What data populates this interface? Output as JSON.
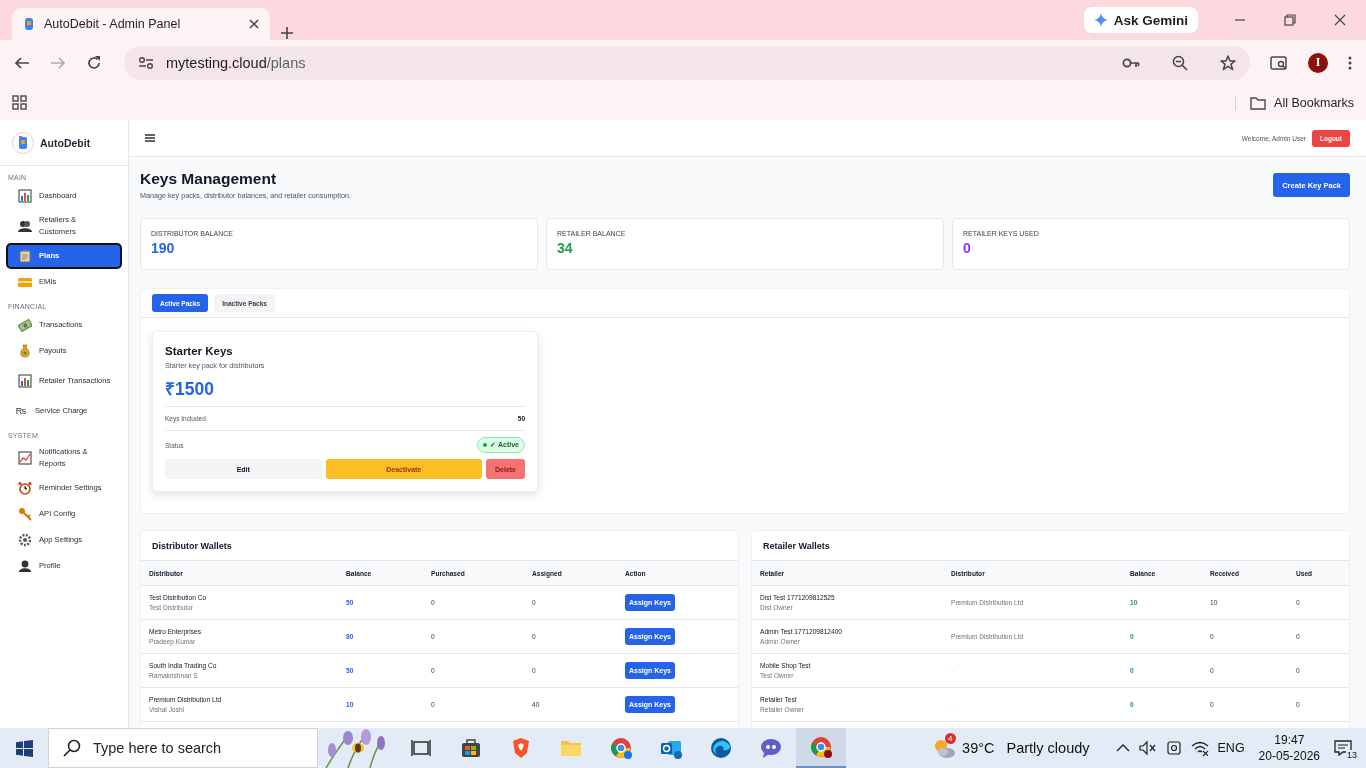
{
  "browser": {
    "tab_title": "AutoDebit - Admin Panel",
    "ask_gemini": "Ask Gemini",
    "url_host": "mytesting.cloud",
    "url_path": "/plans",
    "bookmarks_label": "All Bookmarks",
    "profile_initial": "I"
  },
  "sidebar": {
    "brand": "AutoDebit",
    "sections": [
      {
        "label": "MAIN",
        "items": [
          {
            "label": "Dashboard",
            "selected": false
          },
          {
            "label": "Retailers & Customers",
            "selected": false
          },
          {
            "label": "Plans",
            "selected": true
          },
          {
            "label": "EMIs",
            "selected": false
          }
        ]
      },
      {
        "label": "FINANCIAL",
        "items": [
          {
            "label": "Transactions",
            "selected": false
          },
          {
            "label": "Payouts",
            "selected": false
          },
          {
            "label": "Retailer Transactions",
            "selected": false
          },
          {
            "label": "Service Charge",
            "selected": false,
            "glyph": "₨"
          }
        ]
      },
      {
        "label": "SYSTEM",
        "items": [
          {
            "label": "Notifications & Reports",
            "selected": false
          },
          {
            "label": "Reminder Settings",
            "selected": false
          },
          {
            "label": "API Config",
            "selected": false
          },
          {
            "label": "App Settings",
            "selected": false
          },
          {
            "label": "Profile",
            "selected": false
          }
        ]
      }
    ]
  },
  "header": {
    "welcome": "Welcome, Admin User",
    "logout": "Logout"
  },
  "page": {
    "title": "Keys Management",
    "subtitle": "Manage key packs, distributor balances, and retailer consumption.",
    "create_button": "Create Key Pack"
  },
  "stats": [
    {
      "label": "DISTRIBUTOR BALANCE",
      "value": "190",
      "color": "#2563eb"
    },
    {
      "label": "RETAILER BALANCE",
      "value": "34",
      "color": "#16a34a"
    },
    {
      "label": "RETAILER KEYS USED",
      "value": "0",
      "color": "#9333ea"
    }
  ],
  "pack_tabs": [
    {
      "label": "Active Packs",
      "selected": true
    },
    {
      "label": "Inactive Packs",
      "selected": false
    }
  ],
  "pack_card": {
    "name": "Starter Keys",
    "description": "Starter key pack for distributors",
    "price": "₹1500",
    "keys_label": "Keys Included",
    "keys_value": "50",
    "status_label": "Status",
    "status_badge": "✓ Active",
    "active": true,
    "buttons": [
      {
        "label": "Edit",
        "kind": "edit"
      },
      {
        "label": "Deactivate",
        "kind": "deactivate"
      },
      {
        "label": "Delete",
        "kind": "delete"
      }
    ]
  },
  "distributor_wallets": {
    "title": "Distributor Wallets",
    "columns": [
      "Distributor",
      "Balance",
      "Purchased",
      "Assigned",
      "Action"
    ],
    "rows": [
      {
        "name": "Test Distribution Co",
        "owner": "Test Distributor",
        "balance": "50",
        "purchased": "0",
        "assigned": "0",
        "action": "Assign Keys"
      },
      {
        "name": "Metro Enterprises",
        "owner": "Pradeep Kumar",
        "balance": "80",
        "purchased": "0",
        "assigned": "0",
        "action": "Assign Keys"
      },
      {
        "name": "South India Trading Co",
        "owner": "Ramakrishnan S",
        "balance": "50",
        "purchased": "0",
        "assigned": "0",
        "action": "Assign Keys"
      },
      {
        "name": "Premium Distribution Ltd",
        "owner": "Vishal Joshi",
        "balance": "10",
        "purchased": "0",
        "assigned": "40",
        "action": "Assign Keys"
      }
    ]
  },
  "retailer_wallets": {
    "title": "Retailer Wallets",
    "columns": [
      "Retailer",
      "Distributor",
      "Balance",
      "Received",
      "Used"
    ],
    "rows": [
      {
        "name": "Dist Test 1771209812525",
        "owner": "Dist Owner",
        "distributor": "Premium Distribution Ltd",
        "balance": "10",
        "received": "10",
        "used": "0"
      },
      {
        "name": "Admin Test 1771209812400",
        "owner": "Admin Owner",
        "distributor": "Premium Distribution Ltd",
        "balance": "0",
        "received": "0",
        "used": "0"
      },
      {
        "name": "Mobile Shop Test",
        "owner": "Test Owner",
        "distributor": "-",
        "balance": "0",
        "received": "0",
        "used": "0"
      },
      {
        "name": "Retailer Test",
        "owner": "Retailer Owner",
        "distributor": "-",
        "balance": "0",
        "received": "0",
        "used": "0"
      }
    ]
  },
  "taskbar": {
    "search_placeholder": "Type here to search",
    "weather_badge": "4",
    "temperature": "39°C",
    "weather": "Partly cloudy",
    "language": "ENG",
    "time": "19:47",
    "date": "20-05-2026",
    "notifications": "13"
  }
}
